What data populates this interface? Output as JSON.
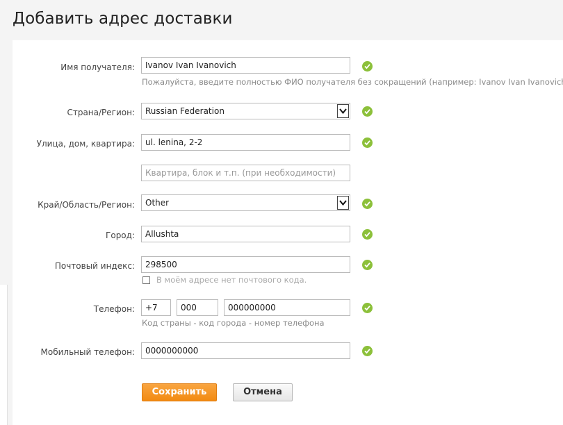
{
  "page": {
    "title": "Добавить адрес доставки"
  },
  "form": {
    "recipient": {
      "label": "Имя получателя:",
      "value": "Ivanov Ivan Ivanovich",
      "hint": "Пожалуйста, введите полностью ФИО получателя без сокращений (например: Ivanov Ivan Ivanovich)."
    },
    "country": {
      "label": "Страна/Регион:",
      "value": "Russian Federation"
    },
    "street": {
      "label": "Улица, дом, квартира:",
      "value": "ul. lenina, 2-2",
      "apartment_placeholder": "Квартира, блок и т.п. (при необходимости)"
    },
    "region": {
      "label": "Край/Область/Регион:",
      "value": "Other"
    },
    "city": {
      "label": "Город:",
      "value": "Allushta"
    },
    "postal": {
      "label": "Почтовый индекс:",
      "value": "298500",
      "no_code_label": "В моём адресе нет почтового кода."
    },
    "phone": {
      "label": "Телефон:",
      "country_code": "+7",
      "area_code": "000",
      "number": "000000000",
      "hint": "Код страны - код города - номер телефона"
    },
    "mobile": {
      "label": "Мобильный телефон:",
      "value": "0000000000"
    }
  },
  "buttons": {
    "save": "Сохранить",
    "cancel": "Отмена"
  },
  "colors": {
    "accent": "#f7931e",
    "valid": "#8cc03a"
  },
  "icons": {
    "valid": "check-circle-icon",
    "dropdown": "chevron-down-icon"
  }
}
